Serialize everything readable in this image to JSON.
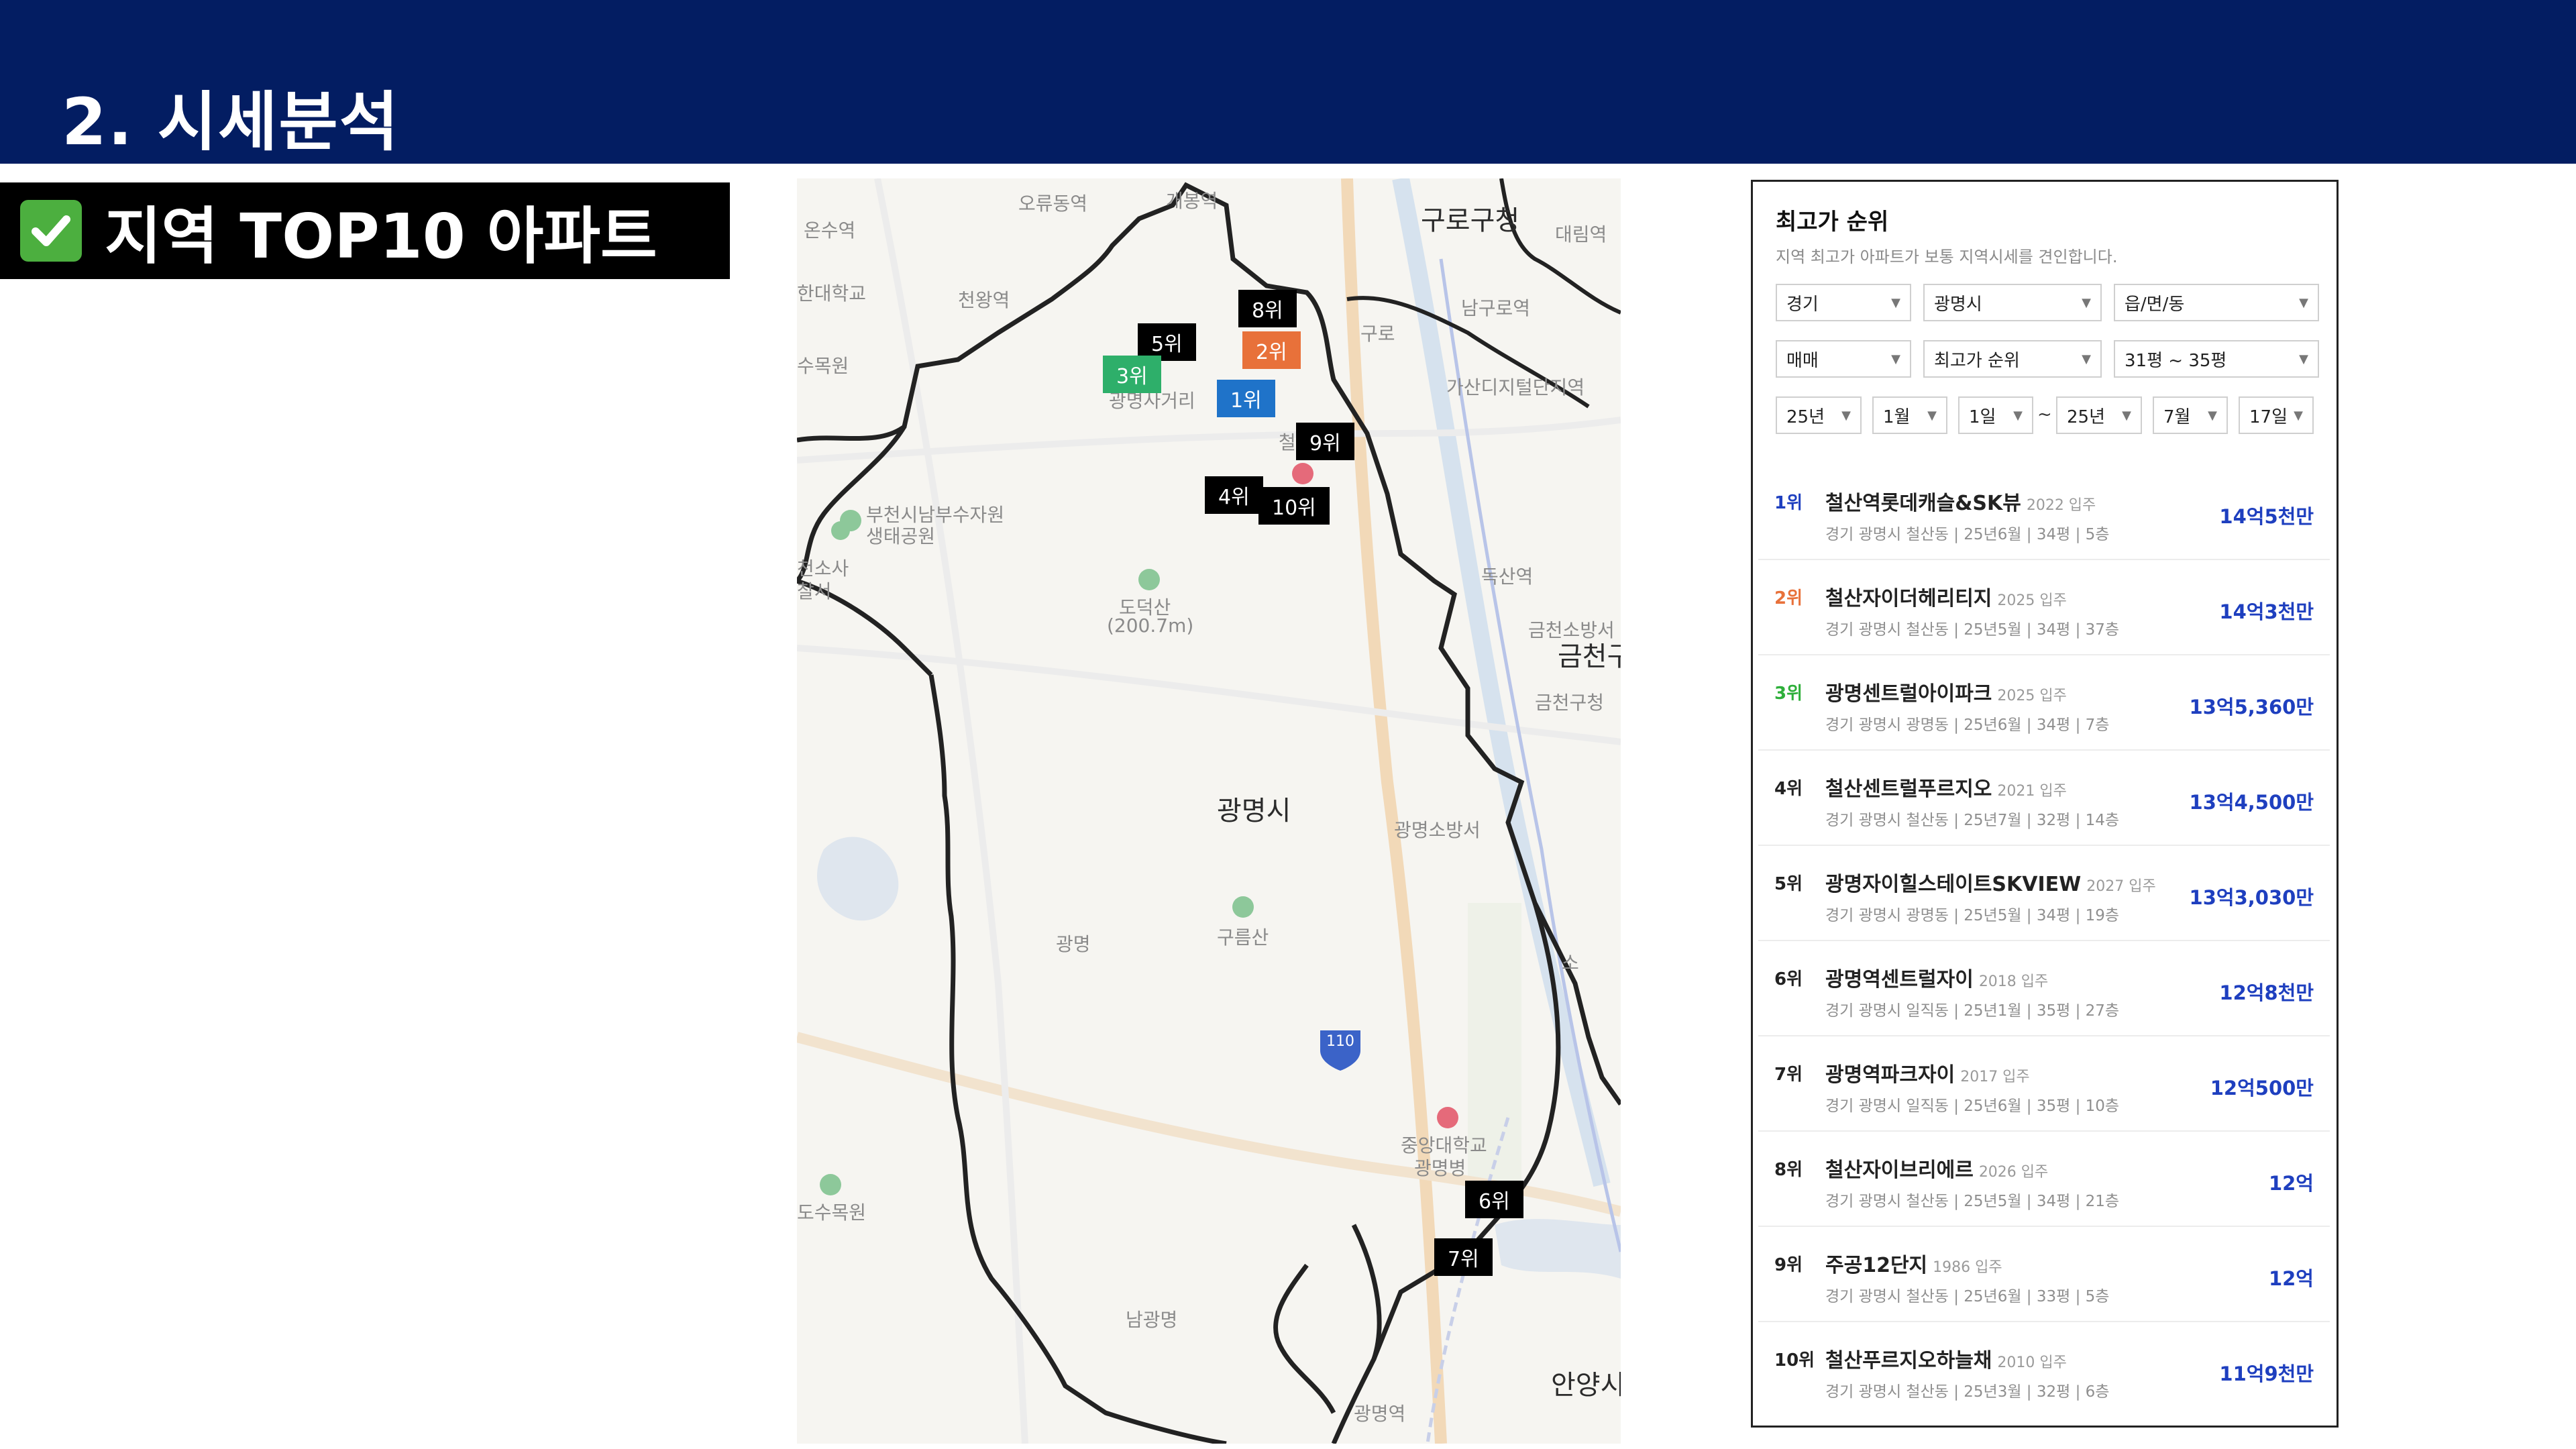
{
  "header": {
    "title": "2. 시세분석"
  },
  "section": {
    "check_icon": "check-mark-icon",
    "title": "지역 TOP10 아파트"
  },
  "map": {
    "labels": {
      "guro_station": "구로구청",
      "daerim": "대림역",
      "gaebong": "개봉역",
      "oryu": "오류동역",
      "onsu": "온수역",
      "hanguk_univ": "한대학교",
      "cheonwang": "천왕역",
      "namguro": "남구로역",
      "gasan": "가산디지털단지역",
      "arboretum": "수목원",
      "gwangmyeong_crossroad": "광명사거리",
      "cheolsan": "철",
      "bucheon_park": "부천시남부수자원",
      "bucheon_park2": "생태공원",
      "dongsa": "천소사",
      "dongsa2": "찰서",
      "doksan": "독산역",
      "dodeoksan": "도덕산",
      "dodeoksan_height": "(200.7m)",
      "geumcheon_fire": "금천소방서",
      "geumcheon": "금천구",
      "geumcheon_office": "금천구청",
      "gwangmyeong_city": "광명시",
      "gwangmyeong_fire": "광명소방서",
      "ic_gwangmyeong": "광명",
      "gureumsan": "구름산",
      "route": "110",
      "chungang_univ": "중앙대학교",
      "chungang_univ2": "광명병",
      "dosu": "도수목원",
      "namgwangmyeong": "남광명",
      "anyang": "안양시",
      "so": "소",
      "ic_gwangmyeong2": "광명역",
      "gu": "구로",
      "guro": "구로"
    },
    "markers": [
      {
        "label": "8위",
        "color": "#000000"
      },
      {
        "label": "5위",
        "color": "#000000"
      },
      {
        "label": "2위",
        "color": "#e8713a"
      },
      {
        "label": "3위",
        "color": "#2eaf6a"
      },
      {
        "label": "1위",
        "color": "#1f73c9"
      },
      {
        "label": "9위",
        "color": "#000000"
      },
      {
        "label": "4위",
        "color": "#000000"
      },
      {
        "label": "10위",
        "color": "#000000"
      },
      {
        "label": "6위",
        "color": "#000000"
      },
      {
        "label": "7위",
        "color": "#000000"
      }
    ]
  },
  "panel": {
    "title": "최고가 순위",
    "subtitle": "지역 최고가 아파트가 보통 지역시세를 견인합니다.",
    "filters_row1": [
      "경기",
      "광명시",
      "읍/면/동"
    ],
    "filters_row2": [
      "매매",
      "최고가 순위",
      "31평 ~ 35평"
    ],
    "date_from": [
      "25년",
      "1월",
      "1일"
    ],
    "tilde": "~",
    "date_to": [
      "25년",
      "7월",
      "17일"
    ],
    "rank_colors": {
      "1": "#1e3fbf",
      "2": "#e8713a",
      "3": "#2eaf3a",
      "default": "#222222"
    },
    "rankings": [
      {
        "rank": "1위",
        "name": "철산역롯데캐슬&SK뷰",
        "year": "2022 입주",
        "info": "경기 광명시 철산동 | 25년6월 | 34평 | 5층",
        "price": "14억5천만"
      },
      {
        "rank": "2위",
        "name": "철산자이더헤리티지",
        "year": "2025 입주",
        "info": "경기 광명시 철산동 | 25년5월 | 34평 | 37층",
        "price": "14억3천만"
      },
      {
        "rank": "3위",
        "name": "광명센트럴아이파크",
        "year": "2025 입주",
        "info": "경기 광명시 광명동 | 25년6월 | 34평 | 7층",
        "price": "13억5,360만"
      },
      {
        "rank": "4위",
        "name": "철산센트럴푸르지오",
        "year": "2021 입주",
        "info": "경기 광명시 철산동 | 25년7월 | 32평 | 14층",
        "price": "13억4,500만"
      },
      {
        "rank": "5위",
        "name": "광명자이힐스테이트SKVIEW",
        "year": "2027 입주",
        "info": "경기 광명시 광명동 | 25년5월 | 34평 | 19층",
        "price": "13억3,030만"
      },
      {
        "rank": "6위",
        "name": "광명역센트럴자이",
        "year": "2018 입주",
        "info": "경기 광명시 일직동 | 25년1월 | 35평 | 27층",
        "price": "12억8천만"
      },
      {
        "rank": "7위",
        "name": "광명역파크자이",
        "year": "2017 입주",
        "info": "경기 광명시 일직동 | 25년6월 | 35평 | 10층",
        "price": "12억500만"
      },
      {
        "rank": "8위",
        "name": "철산자이브리에르",
        "year": "2026 입주",
        "info": "경기 광명시 철산동 | 25년5월 | 34평 | 21층",
        "price": "12억"
      },
      {
        "rank": "9위",
        "name": "주공12단지",
        "year": "1986 입주",
        "info": "경기 광명시 철산동 | 25년6월 | 33평 | 5층",
        "price": "12억"
      },
      {
        "rank": "10위",
        "name": "철산푸르지오하늘채",
        "year": "2010 입주",
        "info": "경기 광명시 철산동 | 25년3월 | 32평 | 6층",
        "price": "11억9천만"
      }
    ]
  }
}
